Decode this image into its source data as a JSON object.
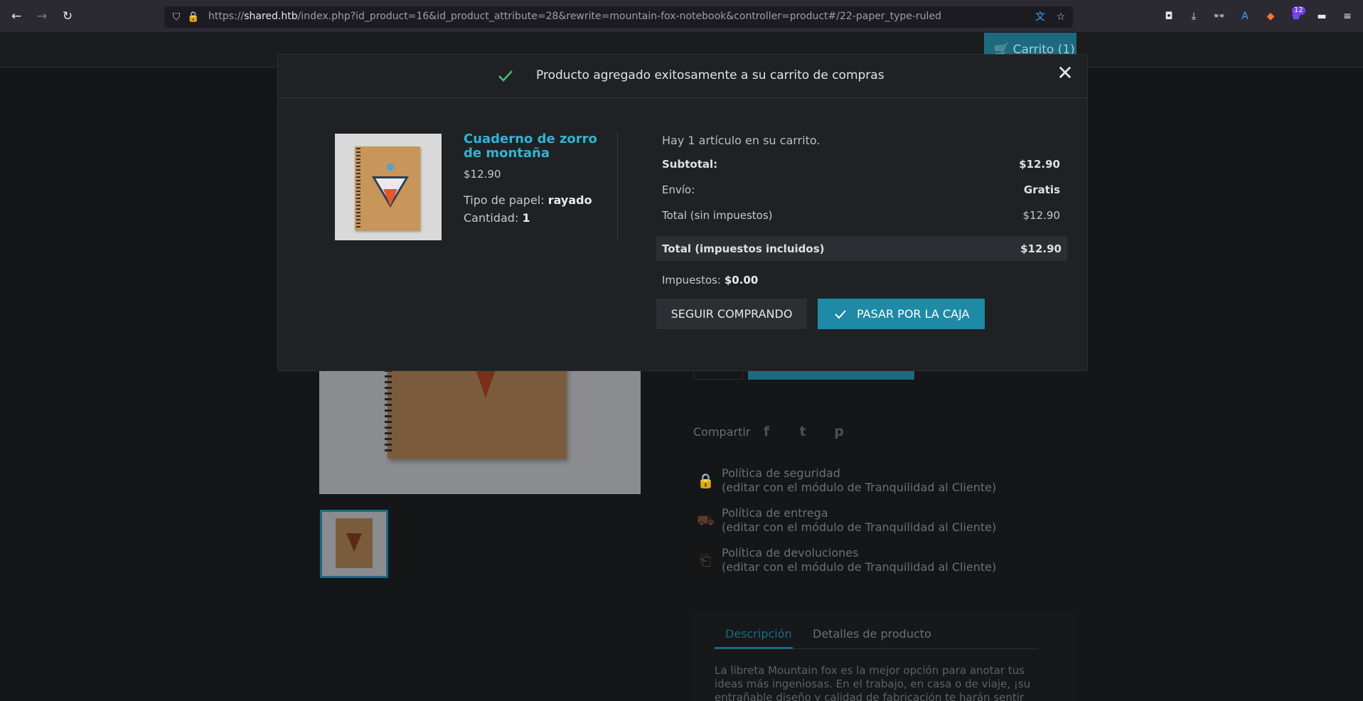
{
  "browser": {
    "url_prefix": "https://",
    "url_host": "shared.htb",
    "url_path": "/index.php?id_product=16&id_product_attribute=28&rewrite=mountain-fox-notebook&controller=product#/22-paper_type-ruled",
    "badge_count": "12"
  },
  "header": {
    "cart_label": "Carrito (1)"
  },
  "page": {
    "share_label": "Compartir",
    "policies": [
      {
        "title": "Política de seguridad",
        "subtitle": "(editar con el módulo de Tranquilidad al Cliente)"
      },
      {
        "title": "Política de entrega",
        "subtitle": "(editar con el módulo de Tranquilidad al Cliente)"
      },
      {
        "title": "Política de devoluciones",
        "subtitle": "(editar con el módulo de Tranquilidad al Cliente)"
      }
    ],
    "tabs": [
      "Descripción",
      "Detalles de producto"
    ],
    "description": "La libreta Mountain fox es la mejor opción para anotar tus ideas más ingeniosas. En el trabajo, en casa o de viaje, ¡su entrañable diseño y calidad de fabricación te harán sentir ganas de escribir!"
  },
  "modal": {
    "title": "Producto agregado exitosamente a su carrito de compras",
    "product": {
      "name": "Cuaderno de zorro de montaña",
      "price": "$12.90",
      "paper_label": "Tipo de papel:",
      "paper_value": "rayado",
      "qty_label": "Cantidad:",
      "qty_value": "1"
    },
    "cart_count": "Hay 1 artículo en su carrito.",
    "subtotal_label": "Subtotal:",
    "subtotal_value": "$12.90",
    "shipping_label": "Envío:",
    "shipping_value": "Gratis",
    "total_ex_label": "Total (sin impuestos)",
    "total_ex_value": "$12.90",
    "total_inc_label": "Total (impuestos incluidos)",
    "total_inc_value": "$12.90",
    "taxes_label": "Impuestos:",
    "taxes_value": "$0.00",
    "continue_label": "SEGUIR COMPRANDO",
    "checkout_label": "PASAR POR LA CAJA"
  },
  "colors": {
    "accent": "#2fb5d2",
    "checkout": "#1e8aa5",
    "success_check": "#4cbb6c"
  }
}
